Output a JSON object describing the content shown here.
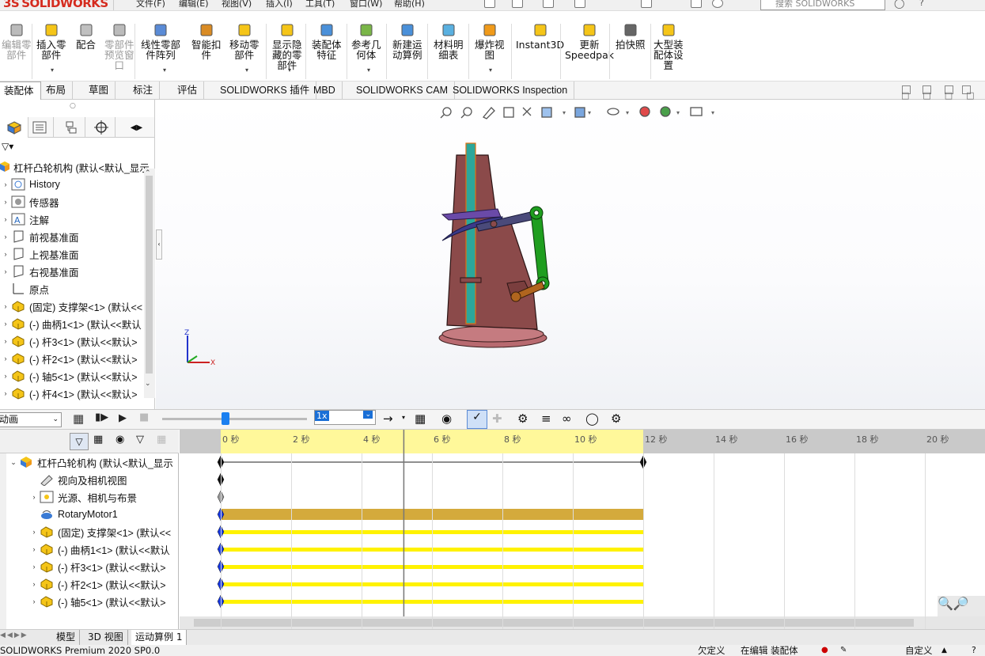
{
  "menu": {
    "items": [
      "文件(F)",
      "编辑(E)",
      "视图(V)",
      "插入(I)",
      "工具(T)",
      "窗口(W)",
      "帮助(H)"
    ],
    "search_placeholder": "搜索 SOLIDWORKS",
    "logo_text": "SOLIDWORKS",
    "logo_mark": "3S"
  },
  "ribbon": {
    "buttons": [
      {
        "label": "编辑零\n部件",
        "disabled": true
      },
      {
        "label": "插入零\n部件",
        "disabled": false
      },
      {
        "label": "配合",
        "disabled": false
      },
      {
        "label": "零部件\n预览窗\n口",
        "disabled": true
      },
      {
        "label": "线性零部\n件阵列",
        "disabled": false
      },
      {
        "label": "智能扣\n件",
        "disabled": false
      },
      {
        "label": "移动零\n部件",
        "disabled": false
      },
      {
        "label": "显示隐\n藏的零\n部件",
        "disabled": false
      },
      {
        "label": "装配体\n特征",
        "disabled": false
      },
      {
        "label": "参考几\n何体",
        "disabled": false
      },
      {
        "label": "新建运\n动算例",
        "disabled": false
      },
      {
        "label": "材料明\n细表",
        "disabled": false
      },
      {
        "label": "爆炸视\n图",
        "disabled": false
      },
      {
        "label": "Instant3D",
        "disabled": false
      },
      {
        "label": "更新\nSpeedpak",
        "disabled": false
      },
      {
        "label": "拍快照",
        "disabled": false
      },
      {
        "label": "大型装\n配体设\n置",
        "disabled": false
      }
    ]
  },
  "tabs": [
    "装配体",
    "布局",
    "草图",
    "标注",
    "评估",
    "SOLIDWORKS 插件",
    "MBD",
    "SOLIDWORKS CAM",
    "SOLIDWORKS Inspection"
  ],
  "tree": {
    "root": "杠杆凸轮机构  (默认<默认_显示",
    "items": [
      {
        "label": "History",
        "type": "history"
      },
      {
        "label": "传感器",
        "type": "sensor"
      },
      {
        "label": "注解",
        "type": "annot"
      },
      {
        "label": "前视基准面",
        "type": "plane"
      },
      {
        "label": "上视基准面",
        "type": "plane"
      },
      {
        "label": "右视基准面",
        "type": "plane"
      },
      {
        "label": "原点",
        "type": "origin"
      },
      {
        "label": "(固定) 支撑架<1> (默认<<",
        "type": "part"
      },
      {
        "label": "(-) 曲柄1<1> (默认<<默认",
        "type": "part"
      },
      {
        "label": "(-) 杆3<1> (默认<<默认>",
        "type": "part"
      },
      {
        "label": "(-) 杆2<1> (默认<<默认>",
        "type": "part"
      },
      {
        "label": "(-) 轴5<1> (默认<<默认>",
        "type": "part"
      },
      {
        "label": "(-) 杆4<1> (默认<<默认>",
        "type": "part"
      }
    ]
  },
  "motion": {
    "study_type": "动画",
    "speed": "1x",
    "tree_root": "杠杆凸轮机构  (默认<默认_显示",
    "rows": [
      {
        "label": "视向及相机视图",
        "arrow": false,
        "icon": "camera"
      },
      {
        "label": "光源、相机与布景",
        "arrow": true,
        "icon": "light"
      },
      {
        "label": "RotaryMotor1",
        "arrow": false,
        "icon": "motor"
      },
      {
        "label": "(固定) 支撑架<1> (默认<<",
        "arrow": true,
        "icon": "part"
      },
      {
        "label": "(-) 曲柄1<1> (默认<<默认",
        "arrow": true,
        "icon": "part"
      },
      {
        "label": "(-) 杆3<1> (默认<<默认>",
        "arrow": true,
        "icon": "part"
      },
      {
        "label": "(-) 杆2<1> (默认<<默认>",
        "arrow": true,
        "icon": "part"
      },
      {
        "label": "(-) 轴5<1> (默认<<默认>",
        "arrow": true,
        "icon": "part"
      }
    ],
    "ticks": [
      "0 秒",
      "2 秒",
      "4 秒",
      "6 秒",
      "8 秒",
      "10 秒",
      "12 秒",
      "14 秒",
      "16 秒",
      "18 秒",
      "20 秒"
    ],
    "duration_s": 12,
    "playhead_s": 5.2
  },
  "bottom_tabs": [
    "模型",
    "3D 视图",
    "运动算例 1"
  ],
  "status": {
    "left": "SOLIDWORKS Premium 2020 SP0.0",
    "underdef": "欠定义",
    "editing": "在编辑 装配体",
    "custom": "自定义"
  },
  "triad": {
    "z": "Z",
    "x": "X"
  },
  "colors": {
    "accent": "#1a7ff0",
    "timeline_yellow": "#fff200",
    "motor_bar": "#d4aa3c",
    "body": "#8b4a4a",
    "crank_green": "#1f9e1f",
    "slider_purple": "#6a4aa8"
  }
}
